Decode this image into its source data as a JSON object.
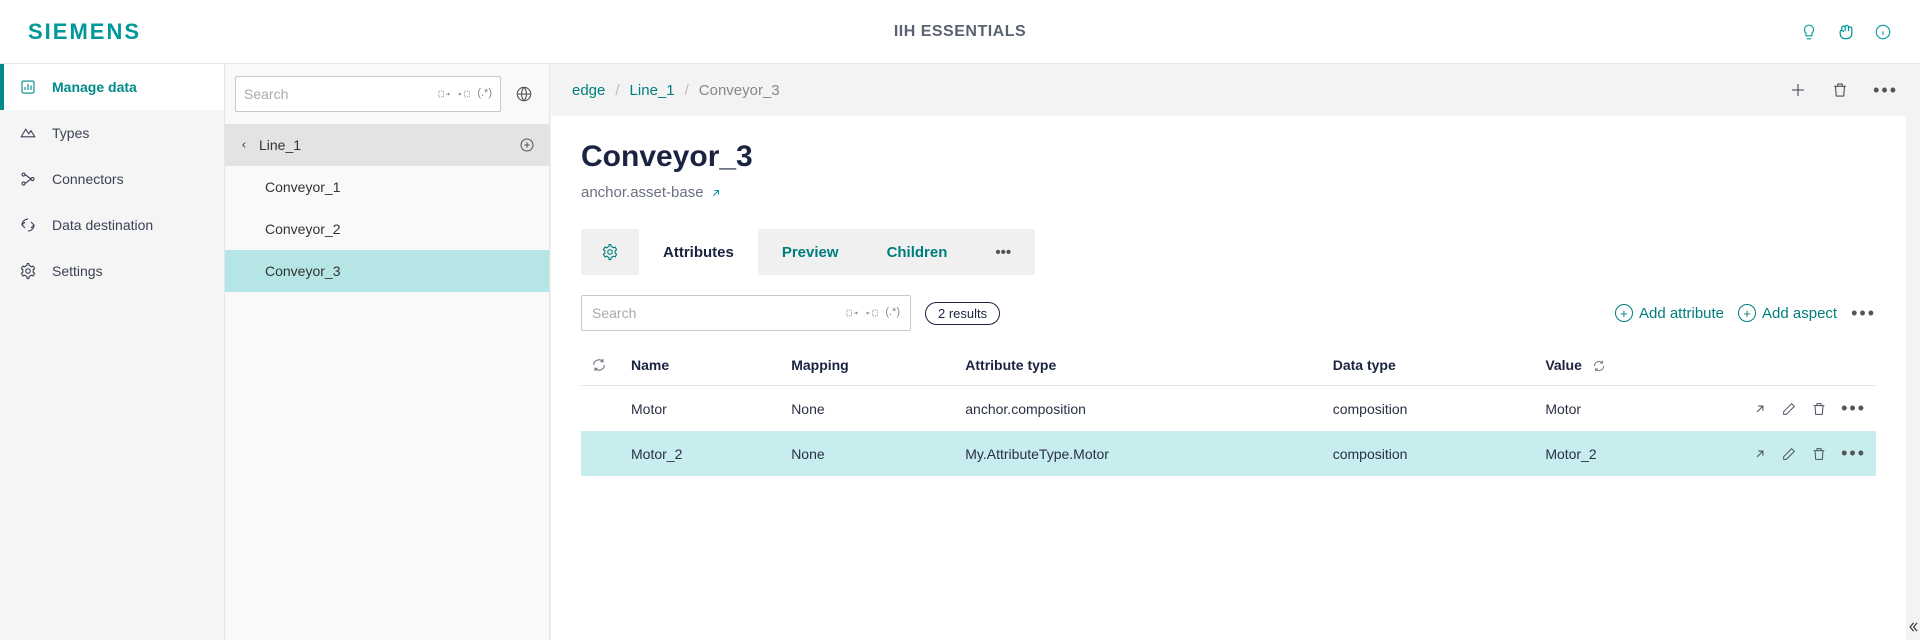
{
  "header": {
    "logo": "SIEMENS",
    "title": "IIH ESSENTIALS"
  },
  "sidebar": {
    "items": [
      {
        "label": "Manage data",
        "active": true
      },
      {
        "label": "Types"
      },
      {
        "label": "Connectors"
      },
      {
        "label": "Data destination"
      },
      {
        "label": "Settings"
      }
    ]
  },
  "tree": {
    "search_placeholder": "Search",
    "parent": "Line_1",
    "children": [
      {
        "label": "Conveyor_1"
      },
      {
        "label": "Conveyor_2"
      },
      {
        "label": "Conveyor_3",
        "selected": true
      }
    ]
  },
  "breadcrumb": {
    "parts": [
      "edge",
      "Line_1",
      "Conveyor_3"
    ]
  },
  "page": {
    "title": "Conveyor_3",
    "subtitle": "anchor.asset-base"
  },
  "tabs": {
    "items": [
      "Attributes",
      "Preview",
      "Children"
    ],
    "active": "Attributes"
  },
  "filter": {
    "search_placeholder": "Search",
    "results": "2 results",
    "add_attribute": "Add attribute",
    "add_aspect": "Add aspect"
  },
  "table": {
    "columns": [
      "Name",
      "Mapping",
      "Attribute type",
      "Data type",
      "Value"
    ],
    "rows": [
      {
        "name": "Motor",
        "mapping": "None",
        "attr_type": "anchor.composition",
        "data_type": "composition",
        "value": "Motor"
      },
      {
        "name": "Motor_2",
        "mapping": "None",
        "attr_type": "My.AttributeType.Motor",
        "data_type": "composition",
        "value": "Motor_2",
        "selected": true
      }
    ]
  }
}
